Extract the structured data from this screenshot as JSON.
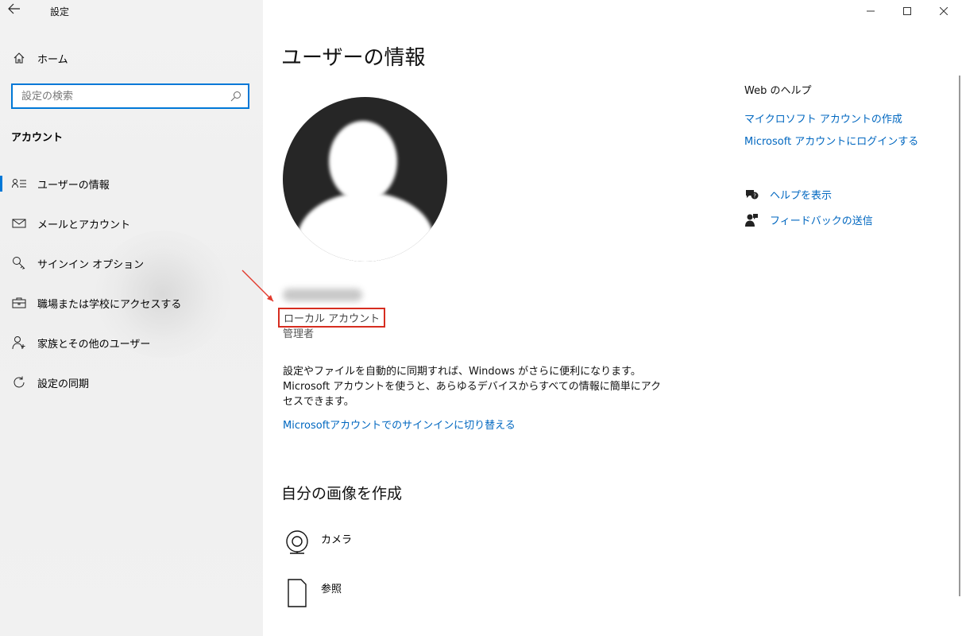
{
  "window": {
    "title": "設定",
    "minimize": "—",
    "maximize": "☐",
    "close": "✕"
  },
  "sidebar": {
    "home_label": "ホーム",
    "search_placeholder": "設定の検索",
    "section_title": "アカウント",
    "items": [
      {
        "label": "ユーザーの情報",
        "icon": "user-info-icon",
        "active": true
      },
      {
        "label": "メールとアカウント",
        "icon": "mail-icon"
      },
      {
        "label": "サインイン オプション",
        "icon": "key-icon"
      },
      {
        "label": "職場または学校にアクセスする",
        "icon": "briefcase-icon"
      },
      {
        "label": "家族とその他のユーザー",
        "icon": "person-add-icon"
      },
      {
        "label": "設定の同期",
        "icon": "sync-icon"
      }
    ]
  },
  "main": {
    "title": "ユーザーの情報",
    "account_type": "ローカル アカウント",
    "role": "管理者",
    "description": "設定やファイルを自動的に同期すれば、Windows がさらに便利になります。Microsoft アカウントを使うと、あらゆるデバイスからすべての情報に簡単にアクセスできます。",
    "switch_link": "Microsoftアカウントでのサインインに切り替える",
    "create_picture_title": "自分の画像を作成",
    "camera_label": "カメラ",
    "browse_label": "参照"
  },
  "right_panel": {
    "help_title": "Web のヘルプ",
    "links": [
      "マイクロソフト アカウントの作成",
      "Microsoft アカウントにログインする"
    ],
    "show_help": "ヘルプを表示",
    "send_feedback": "フィードバックの送信"
  },
  "colors": {
    "accent": "#0078d7",
    "link": "#0067c0",
    "highlight_box": "#d62d20"
  }
}
